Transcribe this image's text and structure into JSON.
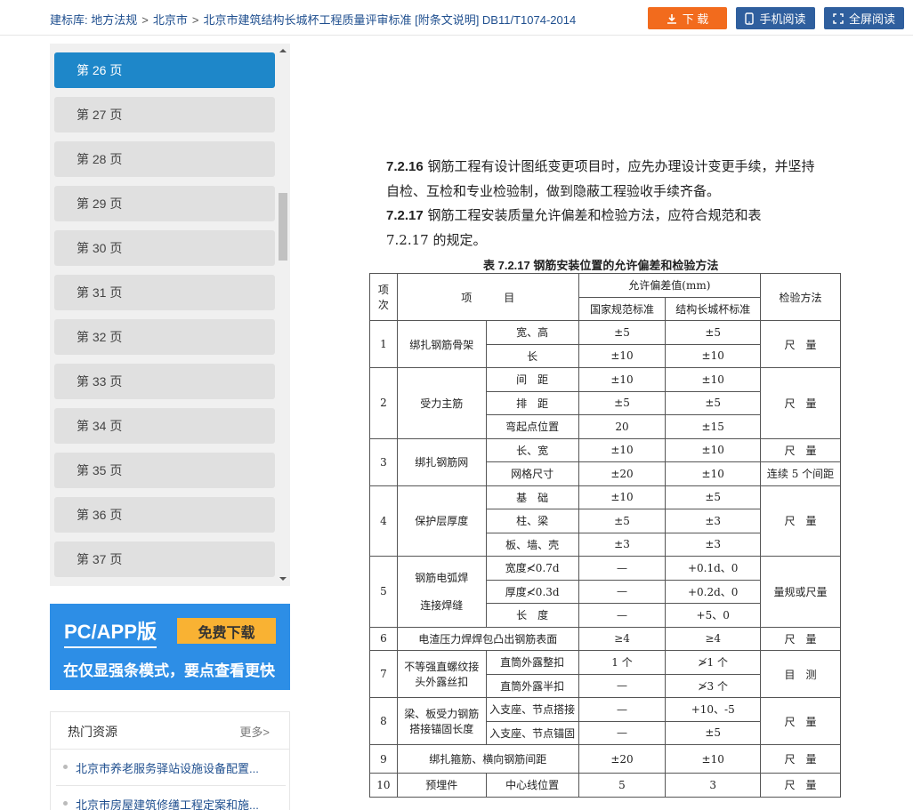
{
  "breadcrumb": {
    "site": "建标库:",
    "c1": "地方法规",
    "c2": "北京市",
    "c3": "北京市建筑结构长城杯工程质量评审标准 [附条文说明] DB11/T1074-2014",
    "sep": ">"
  },
  "toolbar": {
    "download_label": "下 载",
    "mobile_label": "手机阅读",
    "fullscreen_label": "全屏阅读"
  },
  "pages": [
    "第 26 页",
    "第 27 页",
    "第 28 页",
    "第 29 页",
    "第 30 页",
    "第 31 页",
    "第 32 页",
    "第 33 页",
    "第 34 页",
    "第 35 页",
    "第 36 页",
    "第 37 页"
  ],
  "promo": {
    "title": "PC/APP版",
    "button": "免费下载",
    "subtitle": "在仅显强条模式，要点查看更快"
  },
  "hot": {
    "title": "热门资源",
    "more": "更多>",
    "items": [
      "北京市养老服务驿站设施设备配置...",
      "北京市房屋建筑修缮工程定案和施..."
    ]
  },
  "document": {
    "p1_num": "7.2.16",
    "p1_text": " 钢筋工程有设计图纸变更项目时，应先办理设计变更手续，并坚持",
    "p2_text": "自检、互检和专业检验制，做到隐蔽工程验收手续齐备。",
    "p3_num": "7.2.17",
    "p3_text": " 钢筋工程安装质量允许偏差和检验方法，应符合规范和表",
    "p4_text": "7.2.17 的规定。",
    "table_caption": "表 7.2.17 钢筋安装位置的允许偏差和检验方法",
    "table": {
      "h_no": "项\n次",
      "h_no_a": "项",
      "h_no_b": "次",
      "h_item": "项　　　目",
      "h_tol": "允许偏差值(mm)",
      "h_nat": "国家规范标准",
      "h_gw": "结构长城杯标准",
      "h_method": "检验方法",
      "rows": {
        "r1_no": "1",
        "r1_item": "绑扎钢筋骨架",
        "r1a_sub": "宽、高",
        "r1a_nat": "±5",
        "r1a_gw": "±5",
        "r1b_sub": "长",
        "r1b_nat": "±10",
        "r1b_gw": "±10",
        "r1_method": "尺　量",
        "r2_no": "2",
        "r2_item": "受力主筋",
        "r2a_sub": "间　距",
        "r2a_nat": "±10",
        "r2a_gw": "±10",
        "r2b_sub": "排　距",
        "r2b_nat": "±5",
        "r2b_gw": "±5",
        "r2c_sub": "弯起点位置",
        "r2c_nat": "20",
        "r2c_gw": "±15",
        "r2_method": "尺　量",
        "r3_no": "3",
        "r3_item": "绑扎钢筋网",
        "r3a_sub": "长、宽",
        "r3a_nat": "±10",
        "r3a_gw": "±10",
        "r3a_method": "尺　量",
        "r3b_sub": "网格尺寸",
        "r3b_nat": "±20",
        "r3b_gw": "±10",
        "r3b_method": "连续 5 个间距",
        "r4_no": "4",
        "r4_item": "保护层厚度",
        "r4a_sub": "基　础",
        "r4a_nat": "±10",
        "r4a_gw": "±5",
        "r4b_sub": "柱、梁",
        "r4b_nat": "±5",
        "r4b_gw": "±3",
        "r4c_sub": "板、墙、壳",
        "r4c_nat": "±3",
        "r4c_gw": "±3",
        "r4_method": "尺　量",
        "r5_no": "5",
        "r5_item_a": "钢筋电弧焊",
        "r5_item_b": "连接焊缝",
        "r5a_sub": "宽度≮0.7d",
        "r5a_nat": "—",
        "r5a_gw": "+0.1d、0",
        "r5b_sub": "厚度≮0.3d",
        "r5b_nat": "—",
        "r5b_gw": "+0.2d、0",
        "r5c_sub": "长　度",
        "r5c_nat": "—",
        "r5c_gw": "+5、0",
        "r5_method": "量规或尺量",
        "r6_no": "6",
        "r6_item": "电渣压力焊焊包凸出钢筋表面",
        "r6_nat": "≥4",
        "r6_gw": "≥4",
        "r6_method": "尺　量",
        "r7_no": "7",
        "r7_item_a": "不等强直螺纹接",
        "r7_item_b": "头外露丝扣",
        "r7a_sub": "直筒外露整扣",
        "r7a_nat": "1 个",
        "r7a_gw": "≯1 个",
        "r7b_sub": "直筒外露半扣",
        "r7b_nat": "—",
        "r7b_gw": "≯3 个",
        "r7_method": "目　测",
        "r8_no": "8",
        "r8_item_a": "梁、板受力钢筋",
        "r8_item_b": "搭接锚固长度",
        "r8a_sub": "入支座、节点搭接",
        "r8a_nat": "—",
        "r8a_gw": "+10、-5",
        "r8b_sub": "入支座、节点锚固",
        "r8b_nat": "—",
        "r8b_gw": "±5",
        "r8_method": "尺　量",
        "r9_no": "9",
        "r9_item": "绑扎箍筋、横向钢筋间距",
        "r9_nat": "±20",
        "r9_gw": "±10",
        "r9_method": "尺　量",
        "r10_no": "10",
        "r10_item": "预埋件",
        "r10_sub": "中心线位置",
        "r10_nat": "5",
        "r10_gw": "3",
        "r10_method": "尺　量"
      }
    }
  },
  "colors": {
    "accent_blue": "#1e87c9",
    "download_orange": "#f26b1d",
    "toolbar_blue": "#2f5f9e",
    "promo_blue": "#2d8ee6",
    "promo_yellow": "#f9b233"
  }
}
